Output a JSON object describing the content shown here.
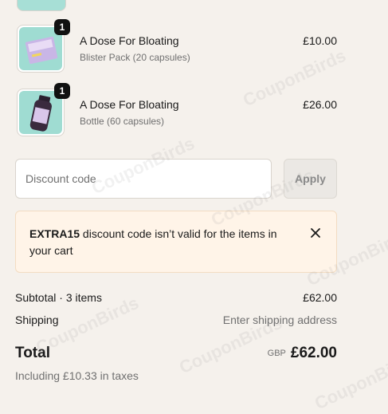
{
  "cart_items": [
    {
      "quantity": "1",
      "name": "A Dose For Bloating",
      "variant": "Blister Pack (20 capsules)",
      "price": "£10.00"
    },
    {
      "quantity": "1",
      "name": "A Dose For Bloating",
      "variant": "Bottle (60 capsules)",
      "price": "£26.00"
    }
  ],
  "discount": {
    "placeholder": "Discount code",
    "apply_label": "Apply"
  },
  "alert": {
    "code": "EXTRA15",
    "message": " discount code isn’t valid for the items in your cart"
  },
  "summary": {
    "subtotal_label": "Subtotal · 3 items",
    "subtotal_value": "£62.00",
    "shipping_label": "Shipping",
    "shipping_value": "Enter shipping address",
    "total_label": "Total",
    "currency": "GBP",
    "total_value": "£62.00",
    "taxes": "Including £10.33 in taxes"
  },
  "watermark": "CouponBirds",
  "colors": {
    "page_bg": "#f5f1ec",
    "alert_bg": "#fff4e8",
    "product_teal": "#9fdcd2",
    "badge": "#111111"
  }
}
